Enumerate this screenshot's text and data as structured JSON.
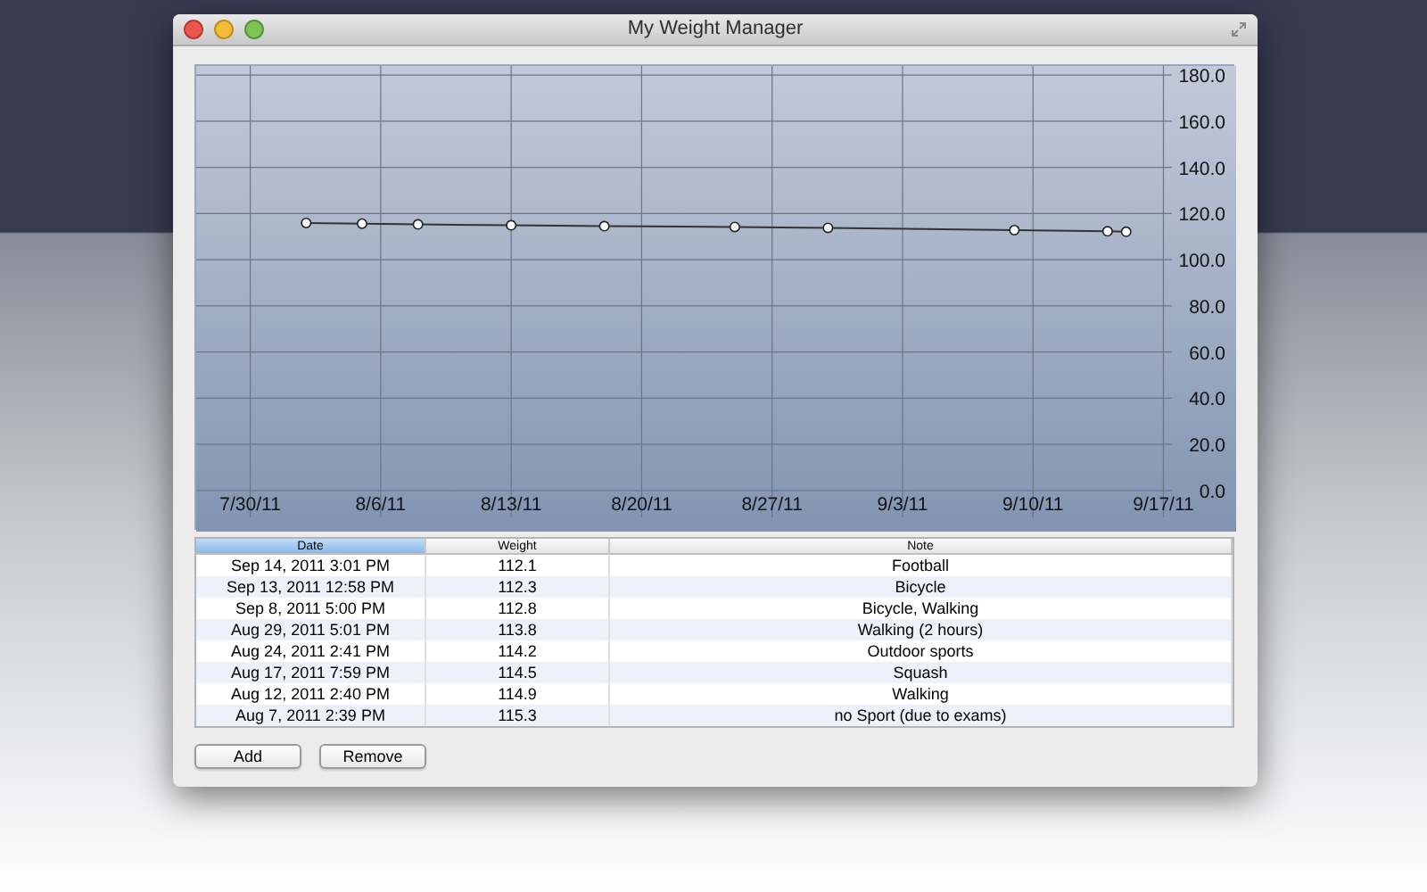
{
  "window": {
    "title": "My Weight Manager"
  },
  "chart": {
    "chart_data": {
      "type": "line",
      "categories": [
        null,
        null,
        null,
        "7/30/11",
        null,
        null,
        null,
        null,
        null,
        null,
        "8/6/11",
        null,
        null,
        null,
        null,
        null,
        null,
        "8/13/11",
        null,
        null,
        null,
        null,
        null,
        null,
        "8/20/11",
        null,
        null,
        null,
        null,
        null,
        null,
        "8/27/11",
        null,
        null,
        null,
        null,
        null,
        null,
        "9/3/11",
        null,
        null,
        null,
        null,
        null,
        null,
        "9/10/11",
        null,
        null,
        null,
        null,
        null,
        null,
        "9/17/11",
        null,
        null,
        null
      ],
      "grid": true,
      "series": [
        {
          "color": "#333333",
          "marker": true,
          "values": [
            null,
            null,
            null,
            null,
            null,
            null,
            115.9,
            null,
            null,
            115.6,
            null,
            null,
            115.3,
            null,
            null,
            null,
            null,
            114.9,
            null,
            null,
            null,
            null,
            114.5,
            null,
            null,
            null,
            null,
            null,
            null,
            114.2,
            null,
            null,
            null,
            null,
            113.8,
            null,
            null,
            null,
            null,
            null,
            null,
            null,
            null,
            null,
            112.8,
            null,
            null,
            null,
            null,
            112.3,
            112.1,
            null,
            null,
            null,
            null,
            null
          ]
        }
      ],
      "ylim": [
        -17.8,
        183.9
      ],
      "yticks": [
        {
          "value": 0,
          "label": "0.0"
        },
        {
          "value": 20,
          "label": "20.0"
        },
        {
          "value": 40,
          "label": "40.0"
        },
        {
          "value": 60,
          "label": "60.0"
        },
        {
          "value": 80,
          "label": "80.0"
        },
        {
          "value": 100,
          "label": "100.0"
        },
        {
          "value": 120,
          "label": "120.0"
        },
        {
          "value": 140,
          "label": "140.0"
        },
        {
          "value": 160,
          "label": "160.0"
        },
        {
          "value": 180,
          "label": "180.0"
        }
      ]
    }
  },
  "table": {
    "columns": [
      {
        "label": "Date",
        "selected": true
      },
      {
        "label": "Weight",
        "selected": false
      },
      {
        "label": "Note",
        "selected": false
      }
    ],
    "rows": [
      [
        "Sep 14, 2011 3:01 PM",
        "112.1",
        "Football"
      ],
      [
        "Sep 13, 2011 12:58 PM",
        "112.3",
        "Bicycle"
      ],
      [
        "Sep 8, 2011 5:00 PM",
        "112.8",
        "Bicycle, Walking"
      ],
      [
        "Aug 29, 2011 5:01 PM",
        "113.8",
        "Walking (2 hours)"
      ],
      [
        "Aug 24, 2011 2:41 PM",
        "114.2",
        "Outdoor sports"
      ],
      [
        "Aug 17, 2011 7:59 PM",
        "114.5",
        "Squash"
      ],
      [
        "Aug 12, 2011 2:40 PM",
        "114.9",
        "Walking"
      ],
      [
        "Aug 7, 2011 2:39 PM",
        "115.3",
        "no Sport (due to exams)"
      ]
    ]
  },
  "buttons": [
    "Add",
    "Remove"
  ]
}
